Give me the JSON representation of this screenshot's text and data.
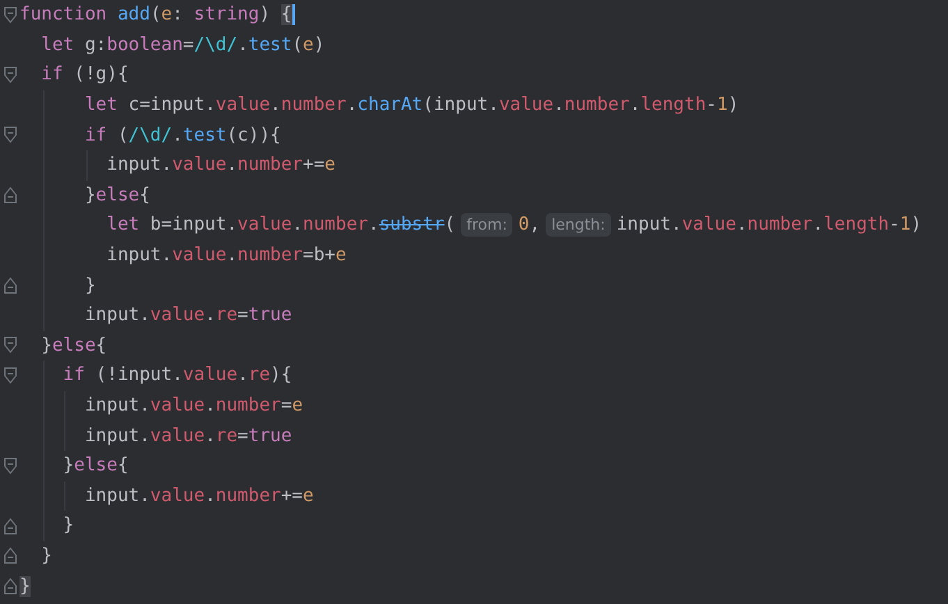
{
  "editor": {
    "lines": [
      {
        "kind": "fold-start",
        "tokens": [
          {
            "t": "function ",
            "kind": "keyword"
          },
          {
            "t": "add",
            "kind": "function"
          },
          {
            "t": "(",
            "kind": "plain"
          },
          {
            "t": "e",
            "kind": "param"
          },
          {
            "t": ": ",
            "kind": "plain"
          },
          {
            "t": "string",
            "kind": "keyword"
          },
          {
            "t": ") ",
            "kind": "plain"
          },
          {
            "t": "{",
            "kind": "brace-match",
            "caret": true
          }
        ]
      },
      {
        "kind": "line",
        "tokens": [
          {
            "t": "  let ",
            "kind": "keyword"
          },
          {
            "t": "g:",
            "kind": "plain"
          },
          {
            "t": "boolean",
            "kind": "keyword"
          },
          {
            "t": "=",
            "kind": "plain"
          },
          {
            "t": "/\\d/",
            "kind": "regex"
          },
          {
            "t": ".",
            "kind": "plain"
          },
          {
            "t": "test",
            "kind": "function"
          },
          {
            "t": "(",
            "kind": "plain"
          },
          {
            "t": "e",
            "kind": "param"
          },
          {
            "t": ")",
            "kind": "plain"
          }
        ]
      },
      {
        "kind": "fold-start",
        "tokens": [
          {
            "t": "  if ",
            "kind": "keyword"
          },
          {
            "t": "(!g){",
            "kind": "plain"
          }
        ]
      },
      {
        "kind": "line",
        "tokens": [
          {
            "t": "      let ",
            "kind": "keyword"
          },
          {
            "t": "c=input.",
            "kind": "plain"
          },
          {
            "t": "value",
            "kind": "property"
          },
          {
            "t": ".",
            "kind": "plain"
          },
          {
            "t": "number",
            "kind": "property"
          },
          {
            "t": ".",
            "kind": "plain"
          },
          {
            "t": "charAt",
            "kind": "function"
          },
          {
            "t": "(input.",
            "kind": "plain"
          },
          {
            "t": "value",
            "kind": "property"
          },
          {
            "t": ".",
            "kind": "plain"
          },
          {
            "t": "number",
            "kind": "property"
          },
          {
            "t": ".",
            "kind": "plain"
          },
          {
            "t": "length",
            "kind": "property"
          },
          {
            "t": "-",
            "kind": "plain"
          },
          {
            "t": "1",
            "kind": "number"
          },
          {
            "t": ")",
            "kind": "plain"
          }
        ]
      },
      {
        "kind": "fold-start",
        "tokens": [
          {
            "t": "      if ",
            "kind": "keyword"
          },
          {
            "t": "(",
            "kind": "plain"
          },
          {
            "t": "/\\d/",
            "kind": "regex"
          },
          {
            "t": ".",
            "kind": "plain"
          },
          {
            "t": "test",
            "kind": "function"
          },
          {
            "t": "(c)){",
            "kind": "plain"
          }
        ]
      },
      {
        "kind": "line",
        "tokens": [
          {
            "t": "        input.",
            "kind": "plain"
          },
          {
            "t": "value",
            "kind": "property"
          },
          {
            "t": ".",
            "kind": "plain"
          },
          {
            "t": "number",
            "kind": "property"
          },
          {
            "t": "+=",
            "kind": "plain"
          },
          {
            "t": "e",
            "kind": "param"
          }
        ]
      },
      {
        "kind": "fold-end",
        "tokens": [
          {
            "t": "      }",
            "kind": "plain"
          },
          {
            "t": "else",
            "kind": "keyword"
          },
          {
            "t": "{",
            "kind": "plain"
          }
        ]
      },
      {
        "kind": "line",
        "tokens": [
          {
            "t": "        let ",
            "kind": "keyword"
          },
          {
            "t": "b=input.",
            "kind": "plain"
          },
          {
            "t": "value",
            "kind": "property"
          },
          {
            "t": ".",
            "kind": "plain"
          },
          {
            "t": "number",
            "kind": "property"
          },
          {
            "t": ".",
            "kind": "plain"
          },
          {
            "t": "substr",
            "kind": "deprecated"
          },
          {
            "t": "(",
            "kind": "plain"
          },
          {
            "t": "from:",
            "kind": "hint"
          },
          {
            "t": "0",
            "kind": "number"
          },
          {
            "t": ",",
            "kind": "plain"
          },
          {
            "t": "length:",
            "kind": "hint"
          },
          {
            "t": "input.",
            "kind": "plain"
          },
          {
            "t": "value",
            "kind": "property"
          },
          {
            "t": ".",
            "kind": "plain"
          },
          {
            "t": "number",
            "kind": "property"
          },
          {
            "t": ".",
            "kind": "plain"
          },
          {
            "t": "length",
            "kind": "property"
          },
          {
            "t": "-",
            "kind": "plain"
          },
          {
            "t": "1",
            "kind": "number"
          },
          {
            "t": ")",
            "kind": "plain"
          }
        ]
      },
      {
        "kind": "line",
        "tokens": [
          {
            "t": "        input.",
            "kind": "plain"
          },
          {
            "t": "value",
            "kind": "property"
          },
          {
            "t": ".",
            "kind": "plain"
          },
          {
            "t": "number",
            "kind": "property"
          },
          {
            "t": "=b+",
            "kind": "plain"
          },
          {
            "t": "e",
            "kind": "param"
          }
        ]
      },
      {
        "kind": "fold-end",
        "tokens": [
          {
            "t": "      }",
            "kind": "plain"
          }
        ]
      },
      {
        "kind": "line",
        "tokens": [
          {
            "t": "      input.",
            "kind": "plain"
          },
          {
            "t": "value",
            "kind": "property"
          },
          {
            "t": ".",
            "kind": "plain"
          },
          {
            "t": "re",
            "kind": "property"
          },
          {
            "t": "=",
            "kind": "plain"
          },
          {
            "t": "true",
            "kind": "keyword"
          }
        ]
      },
      {
        "kind": "fold-start",
        "tokens": [
          {
            "t": "  }",
            "kind": "plain"
          },
          {
            "t": "else",
            "kind": "keyword"
          },
          {
            "t": "{",
            "kind": "plain"
          }
        ]
      },
      {
        "kind": "fold-start",
        "tokens": [
          {
            "t": "    if ",
            "kind": "keyword"
          },
          {
            "t": "(!input.",
            "kind": "plain"
          },
          {
            "t": "value",
            "kind": "property"
          },
          {
            "t": ".",
            "kind": "plain"
          },
          {
            "t": "re",
            "kind": "property"
          },
          {
            "t": "){",
            "kind": "plain"
          }
        ]
      },
      {
        "kind": "line",
        "tokens": [
          {
            "t": "      input.",
            "kind": "plain"
          },
          {
            "t": "value",
            "kind": "property"
          },
          {
            "t": ".",
            "kind": "plain"
          },
          {
            "t": "number",
            "kind": "property"
          },
          {
            "t": "=",
            "kind": "plain"
          },
          {
            "t": "e",
            "kind": "param"
          }
        ]
      },
      {
        "kind": "line",
        "tokens": [
          {
            "t": "      input.",
            "kind": "plain"
          },
          {
            "t": "value",
            "kind": "property"
          },
          {
            "t": ".",
            "kind": "plain"
          },
          {
            "t": "re",
            "kind": "property"
          },
          {
            "t": "=",
            "kind": "plain"
          },
          {
            "t": "true",
            "kind": "keyword"
          }
        ]
      },
      {
        "kind": "fold-start",
        "tokens": [
          {
            "t": "    }",
            "kind": "plain"
          },
          {
            "t": "else",
            "kind": "keyword"
          },
          {
            "t": "{",
            "kind": "plain"
          }
        ]
      },
      {
        "kind": "line",
        "tokens": [
          {
            "t": "      input.",
            "kind": "plain"
          },
          {
            "t": "value",
            "kind": "property"
          },
          {
            "t": ".",
            "kind": "plain"
          },
          {
            "t": "number",
            "kind": "property"
          },
          {
            "t": "+=",
            "kind": "plain"
          },
          {
            "t": "e",
            "kind": "param"
          }
        ]
      },
      {
        "kind": "fold-end",
        "tokens": [
          {
            "t": "    }",
            "kind": "plain"
          }
        ]
      },
      {
        "kind": "fold-end",
        "tokens": [
          {
            "t": "  }",
            "kind": "plain"
          }
        ]
      },
      {
        "kind": "fold-end",
        "tokens": [
          {
            "t": "}",
            "kind": "brace-match",
            "caret": false
          }
        ]
      }
    ]
  }
}
